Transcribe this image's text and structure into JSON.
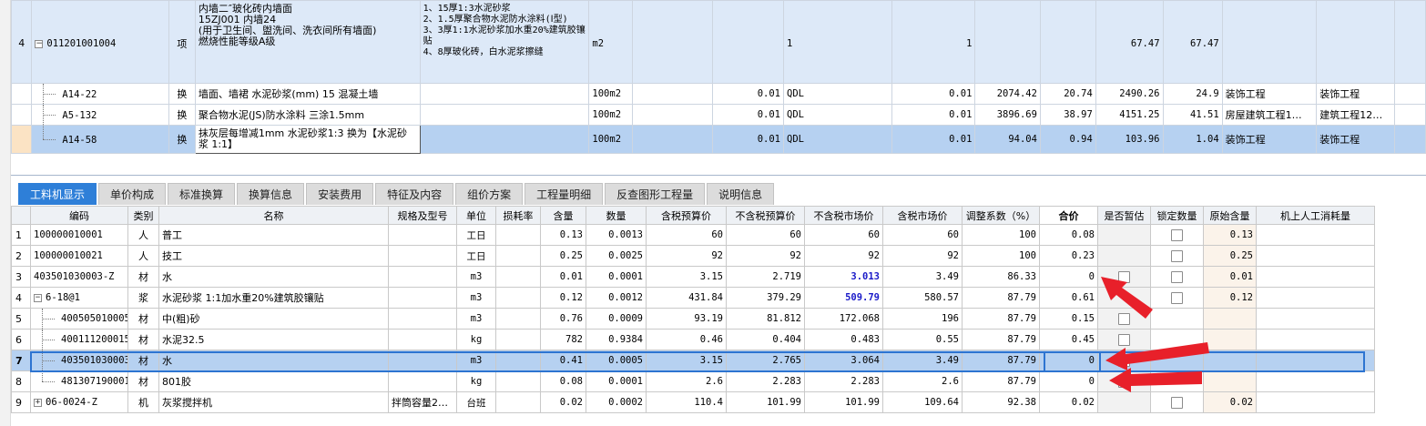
{
  "top": {
    "rows": [
      {
        "no": "4",
        "code": "011201001004",
        "type": "项",
        "name": "内墙二″玻化砖内墙面\n15ZJ001   内墙24\n(用于卫生间、盥洗间、洗衣间所有墙面)\n燃烧性能等级A级",
        "feature": "1、15厚1:3水泥砂浆\n2、1.5厚聚合物水泥防水涂料(Ⅰ型)\n3、3厚1:1水泥砂浆加水重20%建筑胶镶贴\n4、8厚玻化砖，白水泥浆擦缝",
        "unit": "m2",
        "c1": "",
        "c2": "",
        "exprcode": "1",
        "qty": "1",
        "c3": "",
        "c4": "",
        "total": "67.47",
        "price": "67.47",
        "spec": "",
        "major": ""
      },
      {
        "no": "",
        "code": "A14-22",
        "type": "换",
        "name": "墙面、墙裙 水泥砂浆(mm) 15 混凝土墙",
        "feature": "",
        "unit": "100m2",
        "c1": "",
        "c2": "0.01",
        "exprcode": "QDL",
        "qty": "0.01",
        "c3": "2074.42",
        "c4": "20.74",
        "total": "2490.26",
        "price": "24.9",
        "spec": "装饰工程",
        "major": "装饰工程"
      },
      {
        "no": "",
        "code": "A5-132",
        "type": "换",
        "name": "聚合物水泥(JS)防水涂料 三涂1.5mm",
        "feature": "",
        "unit": "100m2",
        "c1": "",
        "c2": "0.01",
        "exprcode": "QDL",
        "qty": "0.01",
        "c3": "3896.69",
        "c4": "38.97",
        "total": "4151.25",
        "price": "41.51",
        "spec": "房屋建筑工程1…",
        "major": "建筑工程12…"
      },
      {
        "no": "",
        "code": "A14-58",
        "type": "换",
        "name": "抹灰层每增减1mm 水泥砂浆1:3  换为【水泥砂浆 1:1】",
        "feature": "",
        "unit": "100m2",
        "c1": "",
        "c2": "0.01",
        "exprcode": "QDL",
        "qty": "0.01",
        "c3": "94.04",
        "c4": "0.94",
        "total": "103.96",
        "price": "1.04",
        "spec": "装饰工程",
        "major": "装饰工程"
      }
    ]
  },
  "tabs": [
    "工料机显示",
    "单价构成",
    "标准换算",
    "换算信息",
    "安装费用",
    "特征及内容",
    "组价方案",
    "工程量明细",
    "反查图形工程量",
    "说明信息"
  ],
  "columns": [
    "",
    "编码",
    "类别",
    "名称",
    "规格及型号",
    "单位",
    "损耗率",
    "含量",
    "数量",
    "含税预算价",
    "不含税预算价",
    "不含税市场价",
    "含税市场价",
    "调整系数（%）",
    "合价",
    "是否暂估",
    "锁定数量",
    "原始含量",
    "机上人工消耗量"
  ],
  "rows": [
    {
      "no": "1",
      "code": "100000010001",
      "type": "人",
      "name": "普工",
      "spec": "",
      "unit": "工日",
      "loss": "",
      "content": "0.13",
      "qty": "0.0013",
      "tax_budget": "60",
      "notax_budget": "60",
      "notax_market": "60",
      "tax_market": "60",
      "adj": "100",
      "total": "0.08",
      "est": false,
      "lock": true,
      "orig": "0.13",
      "machine": ""
    },
    {
      "no": "2",
      "code": "100000010021",
      "type": "人",
      "name": "技工",
      "spec": "",
      "unit": "工日",
      "loss": "",
      "content": "0.25",
      "qty": "0.0025",
      "tax_budget": "92",
      "notax_budget": "92",
      "notax_market": "92",
      "tax_market": "92",
      "adj": "100",
      "total": "0.23",
      "est": false,
      "lock": true,
      "orig": "0.25",
      "machine": ""
    },
    {
      "no": "3",
      "code": "403501030003-Z",
      "type": "材",
      "name": "水",
      "spec": "",
      "unit": "m3",
      "loss": "",
      "content": "0.01",
      "qty": "0.0001",
      "tax_budget": "3.15",
      "notax_budget": "2.719",
      "notax_market": "3.013",
      "tax_market": "3.49",
      "adj": "86.33",
      "total": "0",
      "est": true,
      "lock": true,
      "orig": "0.01",
      "machine": ""
    },
    {
      "no": "4",
      "code": "6-18@1",
      "type": "浆",
      "name": "水泥砂浆 1:1加水重20%建筑胶镶贴",
      "spec": "",
      "unit": "m3",
      "loss": "",
      "content": "0.12",
      "qty": "0.0012",
      "tax_budget": "431.84",
      "notax_budget": "379.29",
      "notax_market": "509.79",
      "tax_market": "580.57",
      "adj": "87.79",
      "total": "0.61",
      "est": false,
      "lock": true,
      "orig": "0.12",
      "machine": ""
    },
    {
      "no": "5",
      "code": "400505010005",
      "type": "材",
      "name": "中(粗)砂",
      "spec": "",
      "unit": "m3",
      "loss": "",
      "content": "0.76",
      "qty": "0.0009",
      "tax_budget": "93.19",
      "notax_budget": "81.812",
      "notax_market": "172.068",
      "tax_market": "196",
      "adj": "87.79",
      "total": "0.15",
      "est": true,
      "lock": false,
      "orig": "",
      "machine": ""
    },
    {
      "no": "6",
      "code": "400111200015",
      "type": "材",
      "name": "水泥32.5",
      "spec": "",
      "unit": "kg",
      "loss": "",
      "content": "782",
      "qty": "0.9384",
      "tax_budget": "0.46",
      "notax_budget": "0.404",
      "notax_market": "0.483",
      "tax_market": "0.55",
      "adj": "87.79",
      "total": "0.45",
      "est": true,
      "lock": false,
      "orig": "",
      "machine": ""
    },
    {
      "no": "7",
      "code": "403501030003",
      "type": "材",
      "name": "水",
      "spec": "",
      "unit": "m3",
      "loss": "",
      "content": "0.41",
      "qty": "0.0005",
      "tax_budget": "3.15",
      "notax_budget": "2.765",
      "notax_market": "3.064",
      "tax_market": "3.49",
      "adj": "87.79",
      "total": "0",
      "est": true,
      "lock": false,
      "orig": "",
      "machine": ""
    },
    {
      "no": "8",
      "code": "481307190001",
      "type": "材",
      "name": "801胶",
      "spec": "",
      "unit": "kg",
      "loss": "",
      "content": "0.08",
      "qty": "0.0001",
      "tax_budget": "2.6",
      "notax_budget": "2.283",
      "notax_market": "2.283",
      "tax_market": "2.6",
      "adj": "87.79",
      "total": "0",
      "est": true,
      "lock": false,
      "orig": "",
      "machine": ""
    },
    {
      "no": "9",
      "code": "06-0024-Z",
      "type": "机",
      "name": "灰浆搅拌机",
      "spec": "拌筒容量2…",
      "unit": "台班",
      "loss": "",
      "content": "0.02",
      "qty": "0.0002",
      "tax_budget": "110.4",
      "notax_budget": "101.99",
      "notax_market": "101.99",
      "tax_market": "109.64",
      "adj": "92.38",
      "total": "0.02",
      "est": false,
      "lock": true,
      "orig": "0.02",
      "machine": ""
    }
  ],
  "colors": {
    "tab_active": "#2e7fd8",
    "selection": "#b6d1f1",
    "arrow": "#e8202a",
    "highlight_text": "#1919c8"
  }
}
